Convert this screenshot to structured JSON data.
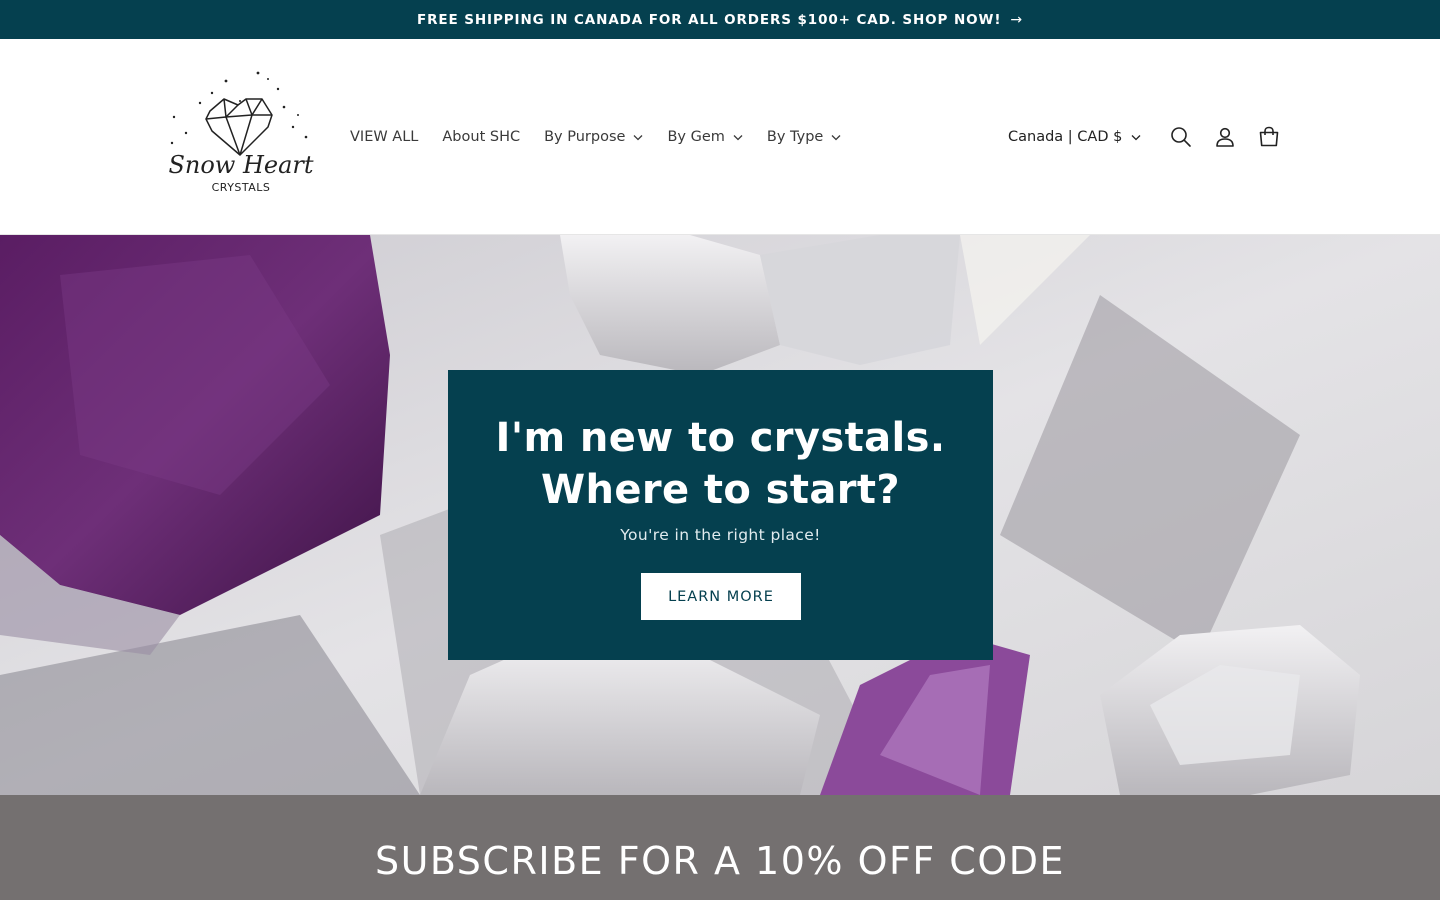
{
  "announcement": {
    "text": "FREE SHIPPING IN CANADA FOR ALL ORDERS $100+ CAD. SHOP NOW!",
    "arrow": "→"
  },
  "header": {
    "logo": {
      "name": "Snow Heart",
      "tagline": "CRYSTALS",
      "icon": "crystal-heart-logo"
    },
    "nav": [
      {
        "label": "VIEW ALL",
        "has_dropdown": false
      },
      {
        "label": "About SHC",
        "has_dropdown": false
      },
      {
        "label": "By Purpose",
        "has_dropdown": true
      },
      {
        "label": "By Gem",
        "has_dropdown": true
      },
      {
        "label": "By Type",
        "has_dropdown": true
      }
    ],
    "locale": "Canada | CAD $",
    "icons": [
      "search-icon",
      "account-icon",
      "cart-icon"
    ]
  },
  "hero": {
    "title_line1": "I'm new to crystals.",
    "title_line2": "Where to start?",
    "subtitle": "You're in the right place!",
    "button_label": "LEARN MORE",
    "background": "amethyst and clear quartz crystals on white marble"
  },
  "subscribe": {
    "title": "SUBSCRIBE FOR A 10% OFF CODE"
  },
  "colors": {
    "brand_teal": "#05404f",
    "subscribe_bg": "#747070",
    "text": "#3a3a3a",
    "white": "#ffffff"
  }
}
